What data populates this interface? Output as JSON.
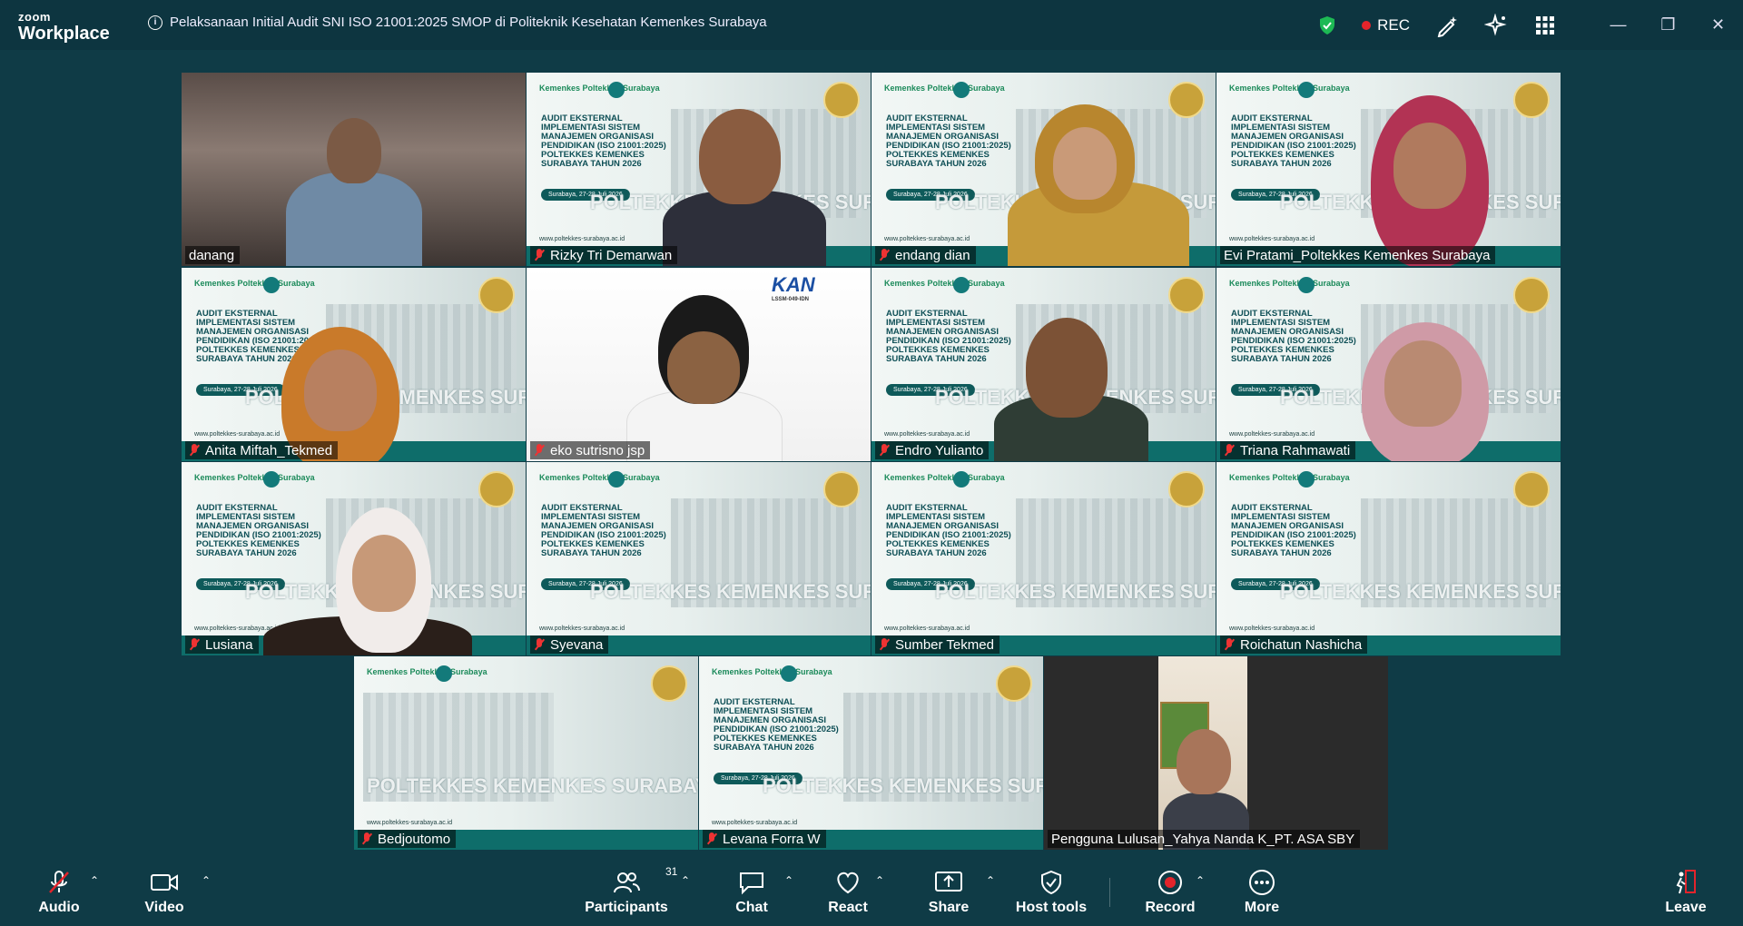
{
  "window": {
    "app_logo_small": "zoom",
    "app_logo_big": "Workplace",
    "meeting_title": "Pelaksanaan Initial Audit SNI ISO 21001:2025 SMOP di Politeknik Kesehatan Kemenkes Surabaya",
    "rec_label": "REC"
  },
  "poster": {
    "brand": "Kemenkes Poltekkes Surabaya",
    "heading": "AUDIT EKSTERNAL IMPLEMENTASI SISTEM MANAJEMEN ORGANISASI PENDIDIKAN (ISO 21001:2025) POLTEKKES KEMENKES SURABAYA TAHUN 2026",
    "date": "Surabaya, 27-28 Juli 2026",
    "banner": "POLTEKKES KEMENKES SURABAYA",
    "url": "www.poltekkes-surabaya.ac.id"
  },
  "kan_logo": {
    "title": "KAN",
    "sub": "LSSM-049-IDN"
  },
  "participants": [
    {
      "name": "danang",
      "muted": false
    },
    {
      "name": "Rizky Tri Demarwan",
      "muted": true
    },
    {
      "name": "endang dian",
      "muted": true
    },
    {
      "name": "Evi Pratami_Poltekkes Kemenkes Surabaya",
      "muted": false
    },
    {
      "name": "Anita Miftah_Tekmed",
      "muted": true
    },
    {
      "name": "eko sutrisno jsp",
      "muted": true
    },
    {
      "name": "Endro Yulianto",
      "muted": true
    },
    {
      "name": "Triana Rahmawati",
      "muted": true
    },
    {
      "name": "Lusiana",
      "muted": true
    },
    {
      "name": "Syevana",
      "muted": true
    },
    {
      "name": "Sumber Tekmed",
      "muted": true
    },
    {
      "name": "Roichatun Nashicha",
      "muted": true
    },
    {
      "name": "Bedjoutomo",
      "muted": true
    },
    {
      "name": "Levana Forra W",
      "muted": true
    },
    {
      "name": "Pengguna Lulusan_Yahya Nanda K_PT. ASA SBY",
      "muted": false
    }
  ],
  "toolbar": {
    "audio": "Audio",
    "video": "Video",
    "participants": "Participants",
    "participants_count": "31",
    "chat": "Chat",
    "react": "React",
    "share": "Share",
    "host_tools": "Host tools",
    "record": "Record",
    "more": "More",
    "leave": "Leave"
  },
  "colors": {
    "background": "#0f3b46",
    "active_speaker": "#33d17a",
    "record_red": "#e3242b",
    "shield_green": "#1db954"
  }
}
